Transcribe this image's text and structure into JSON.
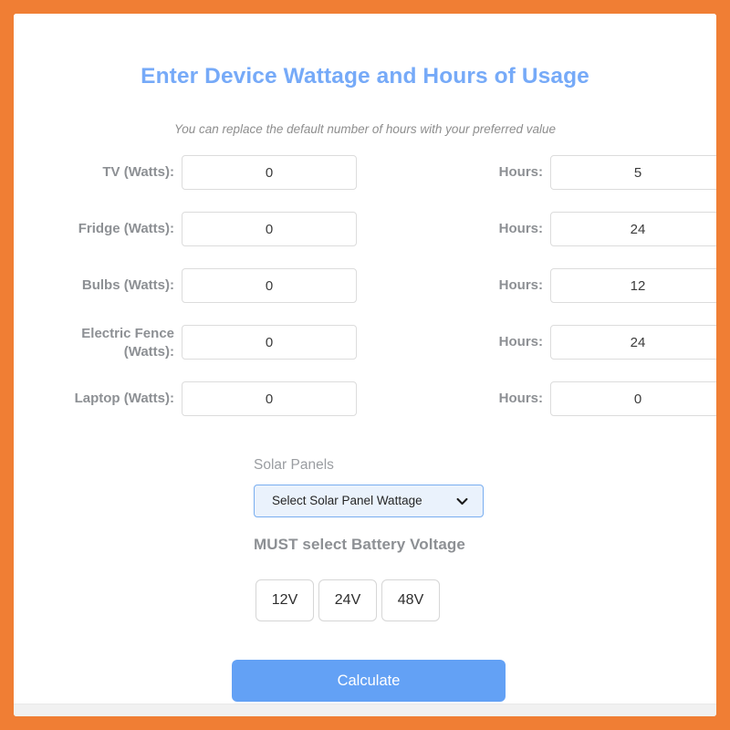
{
  "theme": {
    "border_color": "#f07e34",
    "title_color": "#76aaf8",
    "label_color": "#8d9094",
    "accent_button_color": "#63a1f5",
    "select_border_color": "#79aef0",
    "select_background_color": "#eaf2fc"
  },
  "header": {
    "title": "Enter Device Wattage and Hours of Usage",
    "subtitle": "You can replace the default number of hours with your preferred value"
  },
  "devices": [
    {
      "watt_label": "TV (Watts):",
      "watt_value": "0",
      "hours_label": "Hours:",
      "hours_value": "5",
      "two_lines": false
    },
    {
      "watt_label": "Fridge (Watts):",
      "watt_value": "0",
      "hours_label": "Hours:",
      "hours_value": "24",
      "two_lines": false
    },
    {
      "watt_label": "Bulbs (Watts):",
      "watt_value": "0",
      "hours_label": "Hours:",
      "hours_value": "12",
      "two_lines": false
    },
    {
      "watt_label": "Electric Fence (Watts):",
      "watt_value": "0",
      "hours_label": "Hours:",
      "hours_value": "24",
      "two_lines": true
    },
    {
      "watt_label": "Laptop (Watts):",
      "watt_value": "0",
      "hours_label": "Hours:",
      "hours_value": "0",
      "two_lines": false
    }
  ],
  "solar": {
    "label": "Solar Panels",
    "selected_option": "Select Solar Panel Wattage",
    "chevron_icon": "chevron-down-icon"
  },
  "battery": {
    "title": "MUST select Battery Voltage",
    "options": [
      "12V",
      "24V",
      "48V"
    ]
  },
  "actions": {
    "calculate_label": "Calculate"
  }
}
